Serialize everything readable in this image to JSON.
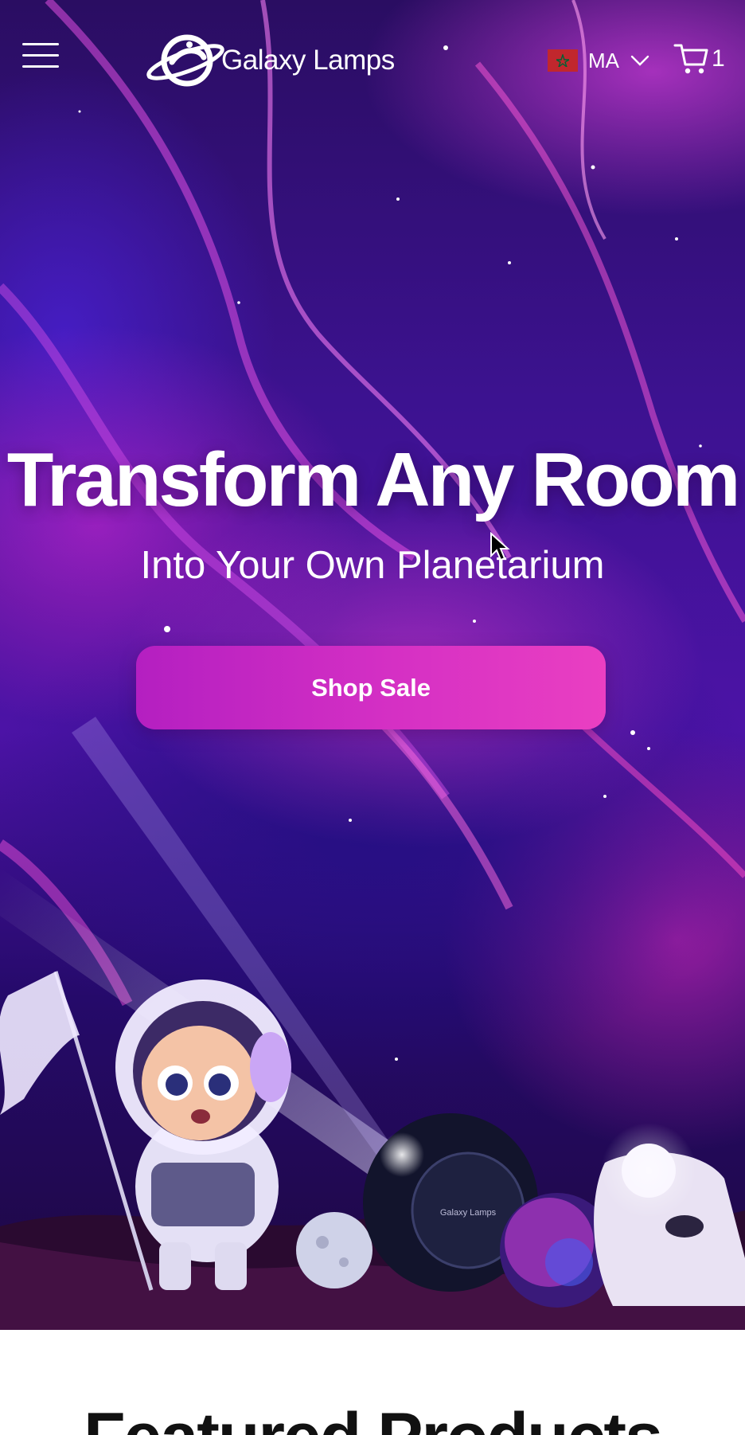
{
  "header": {
    "brand": "Galaxy Lamps",
    "country_code": "MA",
    "cart_count": "1"
  },
  "hero": {
    "title": "Transform Any Room",
    "subtitle": "Into Your Own Planetarium",
    "cta_label": "Shop Sale"
  },
  "featured": {
    "heading": "Featured Products"
  },
  "icons": {
    "menu": "hamburger-menu-icon",
    "logo": "planet-logo-icon",
    "flag": "morocco-flag-icon",
    "dropdown": "chevron-down-icon",
    "cart": "shopping-cart-icon"
  },
  "colors": {
    "cta_start": "#b41fc1",
    "cta_end": "#ea3fc2",
    "hero_dark": "#2a0d62",
    "flag_red": "#c1272d",
    "flag_star": "#006233"
  }
}
